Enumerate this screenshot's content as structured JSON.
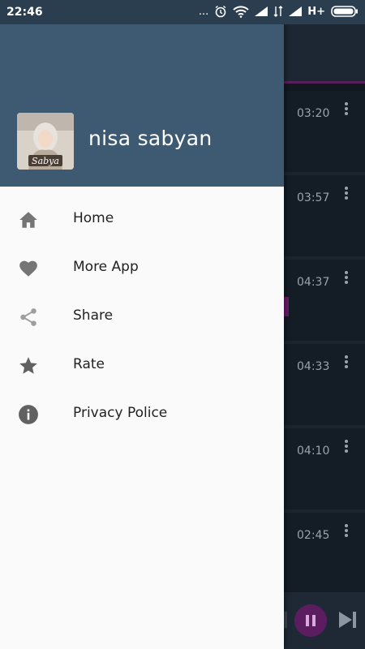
{
  "status_bar": {
    "time": "22:46",
    "dots": "...",
    "network": "H+",
    "icons": [
      "alarm-icon",
      "wifi-icon",
      "signal-icon",
      "data-transfer-icon",
      "signal-icon",
      "battery-icon"
    ]
  },
  "drawer": {
    "title": "nisa sabyan",
    "avatar_text": "Sabya",
    "colors": {
      "header": "#3e5a72",
      "background": "#fafafa"
    },
    "items": [
      {
        "label": "Home",
        "icon": "home-icon"
      },
      {
        "label": "More App",
        "icon": "heart-icon"
      },
      {
        "label": "Share",
        "icon": "share-icon"
      },
      {
        "label": "Rate",
        "icon": "star-icon"
      },
      {
        "label": "Privacy Police",
        "icon": "info-icon"
      }
    ]
  },
  "tracks": [
    {
      "duration": "03:20"
    },
    {
      "duration": "03:57"
    },
    {
      "duration": "04:37"
    },
    {
      "duration": "04:33"
    },
    {
      "duration": "04:10"
    },
    {
      "duration": "02:45"
    }
  ],
  "player": {
    "state": "playing",
    "accent": "#5c1d60"
  }
}
